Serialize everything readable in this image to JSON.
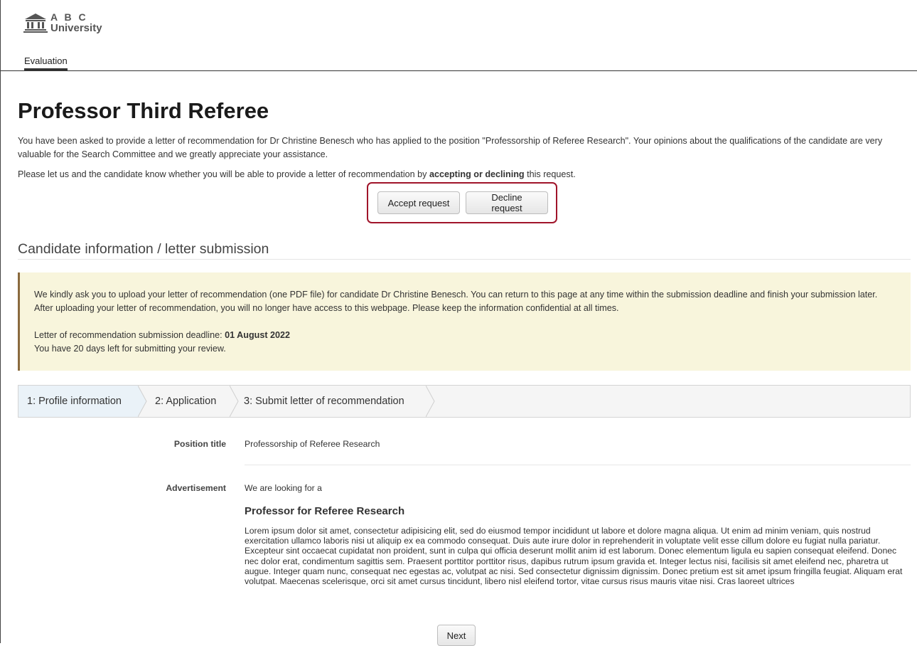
{
  "header": {
    "logo_line1": "A B C",
    "logo_line2": "University",
    "nav_tab": "Evaluation"
  },
  "main": {
    "title": "Professor Third Referee",
    "intro": "You have been asked to provide a letter of recommendation for Dr Christine Benesch who has applied to the position \"Professorship of Referee Research\". Your opinions about the qualifications of the candidate are very valuable for the Search Committee and we greatly appreciate your assistance.",
    "prompt_before": "Please let us and the candidate know whether you will be able to provide a letter of recommendation by ",
    "prompt_bold": "accepting or declining",
    "prompt_after": " this request.",
    "accept_label": "Accept request",
    "decline_label": "Decline request",
    "highlight_color": "#a0142a"
  },
  "section": {
    "title": "Candidate information / letter submission",
    "notice_text": "We kindly ask you to upload your letter of recommendation (one PDF file) for candidate Dr Christine Benesch. You can return to this page at any time within the submission deadline and finish your submission later. After uploading your letter of recommendation, you will no longer have access to this webpage. Please keep the information confidential at all times.",
    "deadline_label": "Letter of recommendation submission deadline: ",
    "deadline_value": "01 August 2022",
    "days_left": "You have 20 days left for submitting your review."
  },
  "wizard": {
    "steps": [
      {
        "label": "1: Profile information",
        "active": true
      },
      {
        "label": "2: Application",
        "active": false
      },
      {
        "label": "3: Submit letter of recommendation",
        "active": false
      }
    ]
  },
  "details": {
    "position_label": "Position title",
    "position_value": "Professorship of Referee Research",
    "advertisement_label": "Advertisement",
    "advertisement_intro": "We are looking for a",
    "advertisement_heading": "Professor for Referee Research",
    "advertisement_body": "Lorem ipsum dolor sit amet, consectetur adipisicing elit, sed do eiusmod tempor incididunt ut labore et dolore magna aliqua. Ut enim ad minim veniam, quis nostrud exercitation ullamco laboris nisi ut aliquip ex ea commodo consequat. Duis aute irure dolor in reprehenderit in voluptate velit esse cillum dolore eu fugiat nulla pariatur. Excepteur sint occaecat cupidatat non proident, sunt in culpa qui officia deserunt mollit anim id est laborum. Donec elementum ligula eu sapien consequat eleifend. Donec nec dolor erat, condimentum sagittis sem. Praesent porttitor porttitor risus, dapibus rutrum ipsum gravida et. Integer lectus nisi, facilisis sit amet eleifend nec, pharetra ut augue. Integer quam nunc, consequat nec egestas ac, volutpat ac nisi. Sed consectetur dignissim dignissim. Donec pretium est sit amet ipsum fringilla feugiat. Aliquam erat volutpat. Maecenas scelerisque, orci sit amet cursus tincidunt, libero nisl eleifend tortor, vitae cursus risus mauris vitae nisi. Cras laoreet ultrices",
    "next_label": "Next"
  }
}
